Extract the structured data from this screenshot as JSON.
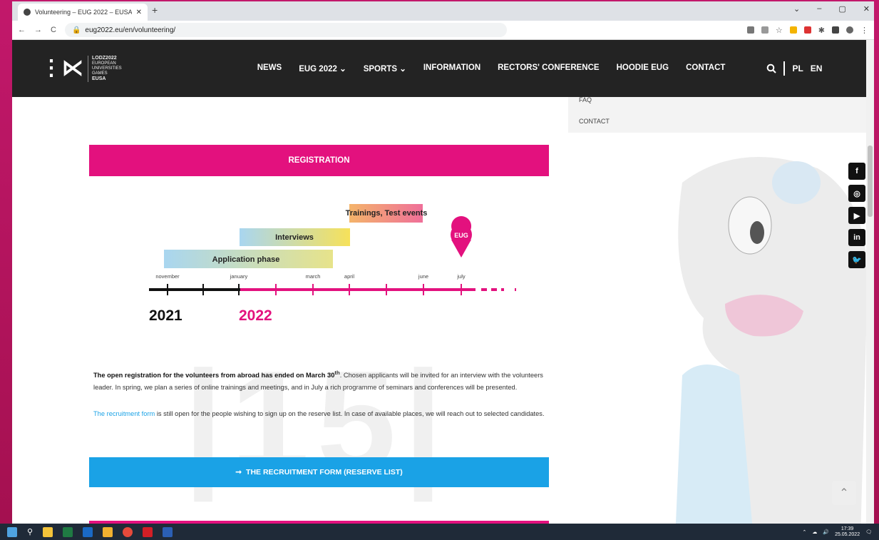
{
  "browser": {
    "tab_title": "Volunteering – EUG 2022 – EUSA",
    "tab_close": "✕",
    "new_tab": "+",
    "window_controls": [
      "⌄",
      "–",
      "▢",
      "✕"
    ],
    "nav_back": "←",
    "nav_forward": "→",
    "reload": "C",
    "url": "eug2022.eu/en/volunteering/"
  },
  "site": {
    "logo_mark": "⋮⋉",
    "logo_lines": [
      "LODZ2022",
      "EUROPEAN",
      "UNIVERSITIES",
      "GAMES"
    ],
    "logo_brand": "EUSA",
    "nav": [
      "NEWS",
      "EUG 2022 ⌄",
      "SPORTS ⌄",
      "INFORMATION",
      "RECTORS' CONFERENCE",
      "HOODIE EUG",
      "CONTACT"
    ],
    "search_icon": "search-icon",
    "lang_pl": "PL",
    "lang_en": "EN"
  },
  "dropdown": {
    "items": [
      "FAQ",
      "CONTACT"
    ]
  },
  "registration": {
    "banner": "REGISTRATION"
  },
  "timeline": {
    "phases": [
      {
        "label": "Trainings, Test events"
      },
      {
        "label": "Interviews"
      },
      {
        "label": "Application phase"
      }
    ],
    "marker": "EUG",
    "months": [
      "november",
      "january",
      "march",
      "april",
      "june",
      "july"
    ],
    "year_2021": "2021",
    "year_2022": "2022"
  },
  "text": {
    "p1_bold": "The open registration for the volunteers from abroad has ended on March 30",
    "p1_sup": "th",
    "p1_rest": ". Chosen applicants will be invited for an interview with the volunteers leader. In spring, we plan a series of online trainings and meetings, and in July a rich programme of seminars and conferences will be presented.",
    "p2_link": "The recruitment form",
    "p2_rest": " is still open for the people wishing to sign up on the reserve list. In case of available places, we will reach out to selected candidates."
  },
  "cta": {
    "arrow": "➞",
    "label": "THE RECRUITMENT FORM (RESERVE LIST)"
  },
  "social": [
    "f",
    "◎",
    "▶",
    "in",
    "🐦"
  ],
  "to_top": "⌃",
  "taskbar": {
    "time": "17:39",
    "date": "25.05.2022"
  },
  "colors": {
    "pink": "#e3117e",
    "blue": "#1aa2e6",
    "header": "#232323"
  }
}
